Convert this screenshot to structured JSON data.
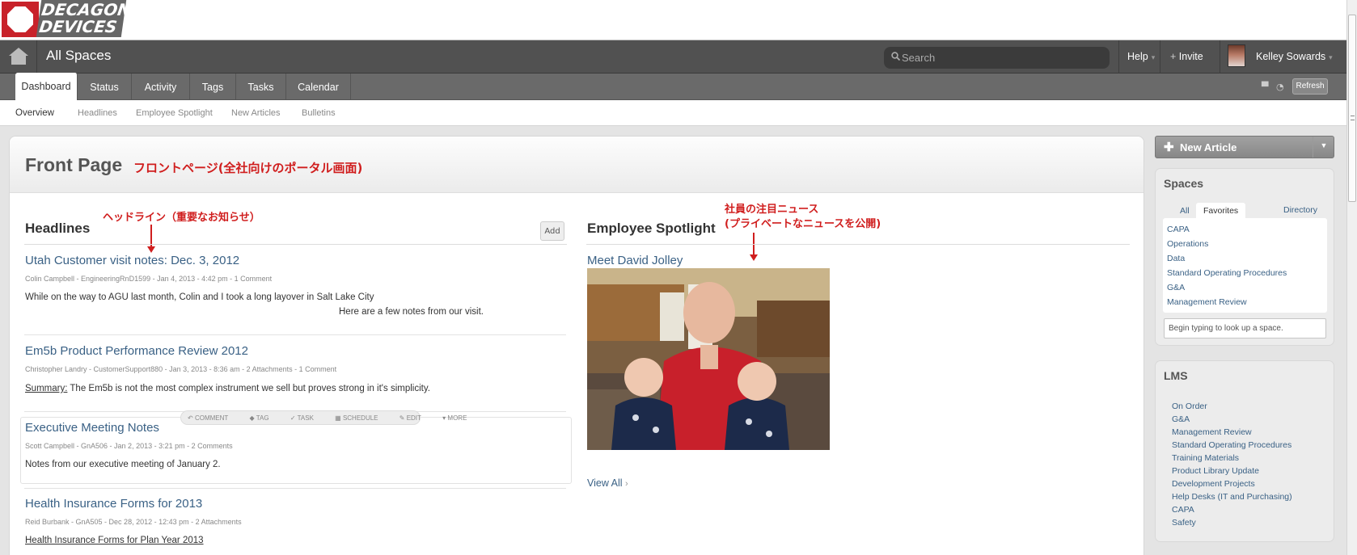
{
  "logo": {
    "line1": "DECAGON",
    "line2": "DEVICES"
  },
  "topbar": {
    "title": "All Spaces",
    "search_placeholder": "Search",
    "help_label": "Help",
    "invite_label": "Invite",
    "user_name": "Kelley Sowards"
  },
  "tabs": [
    {
      "label": "Dashboard",
      "active": true
    },
    {
      "label": "Status"
    },
    {
      "label": "Activity"
    },
    {
      "label": "Tags"
    },
    {
      "label": "Tasks"
    },
    {
      "label": "Calendar"
    }
  ],
  "refresh_label": "Refresh",
  "subnav": [
    "Overview",
    "Headlines",
    "Employee Spotlight",
    "New Articles",
    "Bulletins"
  ],
  "page": {
    "title": "Front Page",
    "title_note": "フロントページ(全社向けのポータル画面)"
  },
  "headlines": {
    "heading": "Headlines",
    "note": "ヘッドライン（重要なお知らせ）",
    "add_label": "Add",
    "articles": [
      {
        "title": "Utah Customer visit notes: Dec. 3, 2012",
        "meta": "Colin Campbell - EngineeringRnD1599 - Jan 4, 2013 - 4:42 pm - 1 Comment",
        "body": "While on the way to AGU last month, Colin and I took a long layover in Salt Lake City",
        "body2": "Here are a few notes from our visit."
      },
      {
        "title": "Em5b Product Performance Review 2012",
        "meta": "Christopher Landry - CustomerSupport880 - Jan 3, 2013 - 8:36 am - 2 Attachments - 1 Comment",
        "body_prefix": "Summary:",
        "body": " The Em5b is not the most complex instrument we sell but proves strong in it's simplicity."
      },
      {
        "title": "Executive Meeting Notes",
        "meta": "Scott Campbell - GnA506 - Jan 2, 2013 - 3:21 pm - 2 Comments",
        "body": "Notes from our executive meeting of January 2."
      },
      {
        "title": "Health Insurance Forms for 2013",
        "meta": "Reid Burbank - GnA505 - Dec 28, 2012 - 12:43 pm - 2 Attachments",
        "body": "Health Insurance Forms for Plan Year 2013"
      }
    ],
    "actions": [
      "COMMENT",
      "TAG",
      "TASK",
      "SCHEDULE",
      "EDIT",
      "MORE"
    ]
  },
  "spotlight": {
    "heading": "Employee Spotlight",
    "note_line1": "社員の注目ニュース",
    "note_line2": "(プライベートなニュースを公開)",
    "article_title": "Meet David Jolley",
    "view_all": "View All"
  },
  "sidebar": {
    "new_article": "New Article",
    "spaces": {
      "heading": "Spaces",
      "tabs": [
        "All",
        "Favorites",
        "Directory"
      ],
      "items": [
        "CAPA",
        "Operations",
        "Data",
        "Standard Operating Procedures",
        "G&A",
        "Management Review"
      ],
      "lookup_placeholder": "Begin typing to look up a space."
    },
    "lms": {
      "heading": "LMS",
      "items": [
        "On Order",
        "G&A",
        "Management Review",
        "Standard Operating Procedures",
        "Training Materials",
        "Product Library Update",
        "Development Projects",
        "Help Desks (IT and Purchasing)",
        "CAPA",
        "Safety"
      ]
    }
  },
  "colors": {
    "accent_red": "#d01e1e",
    "link_blue": "#3a6185",
    "nav_dark": "#515151"
  }
}
